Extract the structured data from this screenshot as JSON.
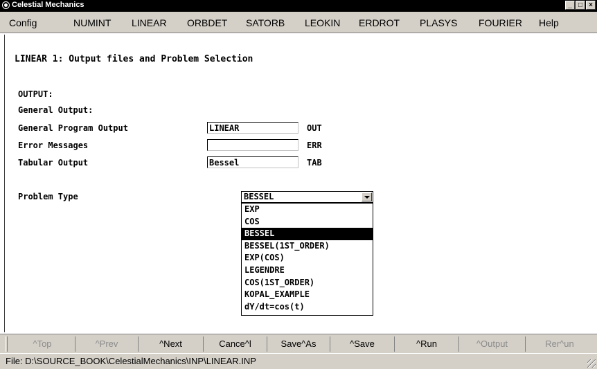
{
  "window": {
    "title": "Celestial Mechanics",
    "controls": [
      "_",
      "□",
      "×"
    ]
  },
  "menu": [
    "Config",
    "NUMINT",
    "LINEAR",
    "ORBDET",
    "SATORB",
    "LEOKIN",
    "ERDROT",
    "PLASYS",
    "FOURIER",
    "Help"
  ],
  "panel": {
    "heading": "LINEAR 1: Output files and Problem Selection",
    "output_label": "OUTPUT:",
    "general_output_label": "General Output:",
    "rows": [
      {
        "label": "General Program Output",
        "value": "LINEAR",
        "ext": "OUT"
      },
      {
        "label": "Error Messages",
        "value": "",
        "ext": "ERR"
      },
      {
        "label": "Tabular Output",
        "value": "Bessel",
        "ext": "TAB"
      }
    ],
    "problem_type_label": "Problem Type",
    "problem_type_value": "BESSEL",
    "options": [
      "EXP",
      "COS",
      "BESSEL",
      "BESSEL(1ST_ORDER)",
      "EXP(COS)",
      "LEGENDRE",
      "COS(1ST_ORDER)",
      "KOPAL_EXAMPLE",
      "dY/dt=cos(t)"
    ],
    "selected_option": "BESSEL"
  },
  "toolbar": {
    "buttons": [
      {
        "label": "^Top",
        "enabled": false
      },
      {
        "label": "^Prev",
        "enabled": false
      },
      {
        "label": "^Next",
        "enabled": true
      },
      {
        "label": "Cance^l",
        "enabled": true
      },
      {
        "label": "Save^As",
        "enabled": true
      },
      {
        "label": "^Save",
        "enabled": true
      },
      {
        "label": "^Run",
        "enabled": true
      },
      {
        "label": "^Output",
        "enabled": false
      },
      {
        "label": "Rer^un",
        "enabled": false
      }
    ]
  },
  "status": {
    "text": "File: D:\\SOURCE_BOOK\\CelestialMechanics\\INP\\LINEAR.INP"
  }
}
